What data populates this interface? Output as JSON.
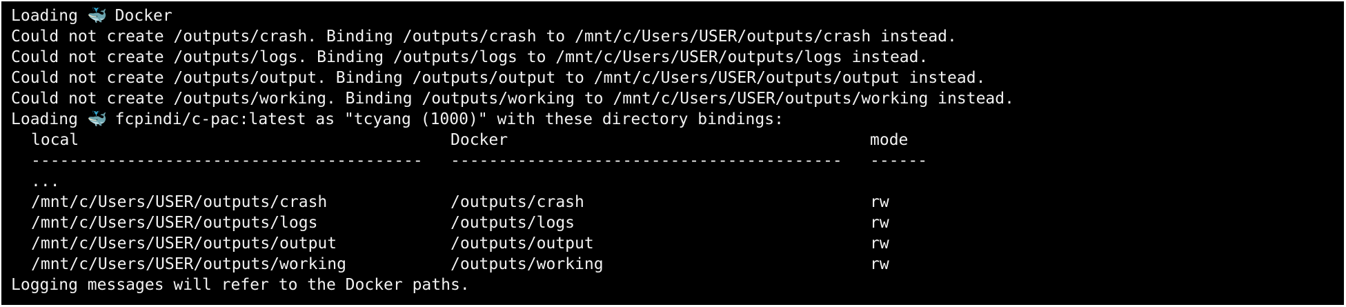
{
  "terminal": {
    "loading_docker": {
      "prefix": "Loading ",
      "icon": "whale-icon",
      "icon_glyph": "🐳",
      "suffix": " Docker"
    },
    "bind_messages": [
      "Could not create /outputs/crash. Binding /outputs/crash to /mnt/c/Users/USER/outputs/crash instead.",
      "Could not create /outputs/logs. Binding /outputs/logs to /mnt/c/Users/USER/outputs/logs instead.",
      "Could not create /outputs/output. Binding /outputs/output to /mnt/c/Users/USER/outputs/output instead.",
      "Could not create /outputs/working. Binding /outputs/working to /mnt/c/Users/USER/outputs/working instead."
    ],
    "loading_image": {
      "prefix": "Loading ",
      "icon": "whale-icon",
      "icon_glyph": "🐳",
      "suffix": " fcpindi/c-pac:latest as \"tcyang (1000)\" with these directory bindings:"
    },
    "table": {
      "headers": {
        "local": "local",
        "docker": "Docker",
        "mode": "mode"
      },
      "separators": {
        "local": "-----------------------------------------",
        "docker": "-----------------------------------------",
        "mode": "------"
      },
      "ellipsis": "...",
      "rows": [
        {
          "local": "/mnt/c/Users/USER/outputs/crash",
          "docker": "/outputs/crash",
          "mode": "rw"
        },
        {
          "local": "/mnt/c/Users/USER/outputs/logs",
          "docker": "/outputs/logs",
          "mode": "rw"
        },
        {
          "local": "/mnt/c/Users/USER/outputs/output",
          "docker": "/outputs/output",
          "mode": "rw"
        },
        {
          "local": "/mnt/c/Users/USER/outputs/working",
          "docker": "/outputs/working",
          "mode": "rw"
        }
      ]
    },
    "footer": "Logging messages will refer to the Docker paths.",
    "colors": {
      "background": "#000000",
      "foreground": "#f2f2f2"
    }
  }
}
